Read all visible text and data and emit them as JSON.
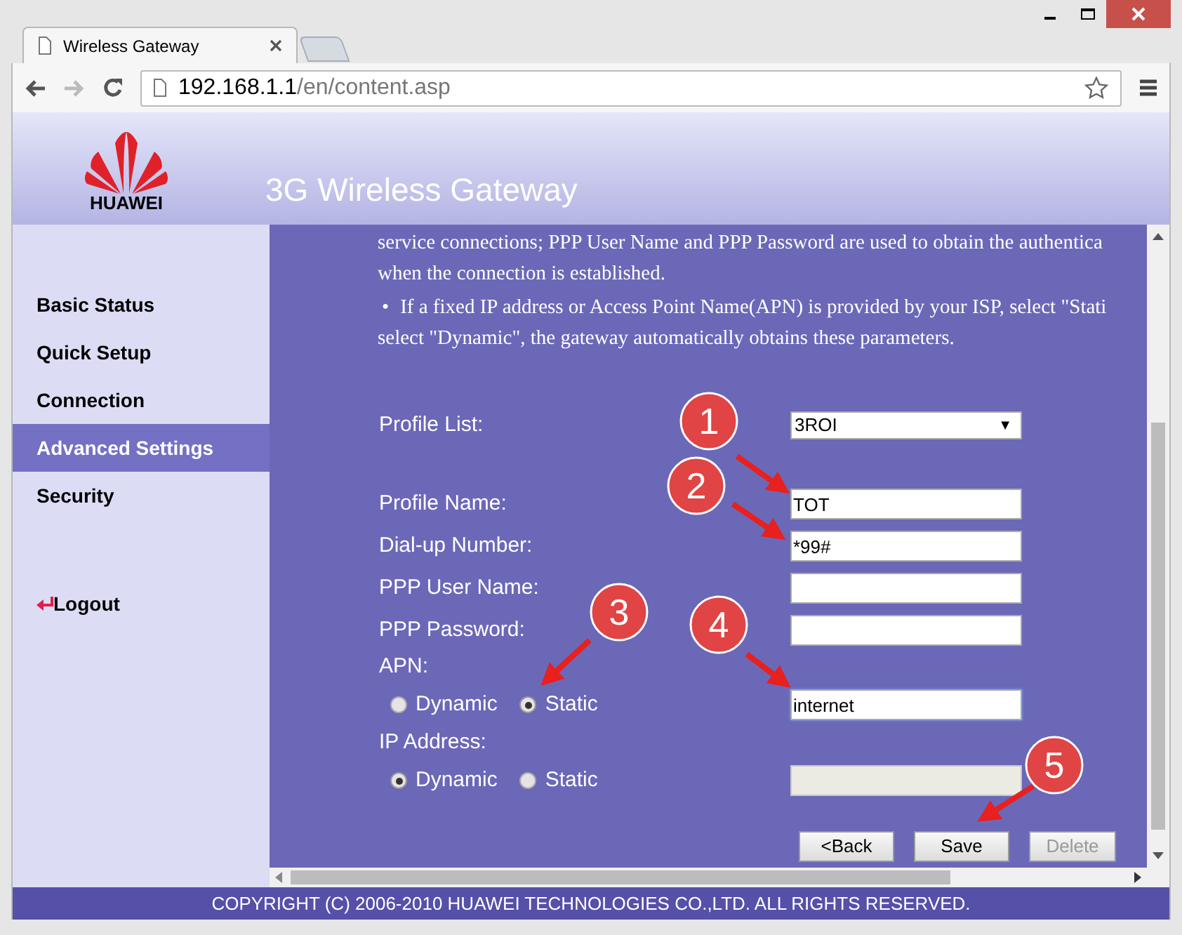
{
  "browser": {
    "tab_title": "Wireless Gateway",
    "url_host": "192.168.1.1",
    "url_path": "/en/content.asp"
  },
  "header": {
    "logo_text": "HUAWEI",
    "title": "3G Wireless Gateway"
  },
  "sidebar": {
    "items": [
      {
        "label": "Basic Status",
        "selected": false
      },
      {
        "label": "Quick Setup",
        "selected": false
      },
      {
        "label": "Connection",
        "selected": false
      },
      {
        "label": "Advanced Settings",
        "selected": true
      },
      {
        "label": "Security",
        "selected": false
      }
    ],
    "logout": "Logout"
  },
  "intro": [
    {
      "kind": "text",
      "text": "service connections; PPP User Name and PPP Password are used to obtain the authentica"
    },
    {
      "kind": "text",
      "text": "when the connection is established."
    },
    {
      "kind": "bullet",
      "bullet": "•",
      "text": "If a fixed IP address or Access Point Name(APN) is provided by your ISP, select \"Stati"
    },
    {
      "kind": "text",
      "text": "select \"Dynamic\", the gateway automatically obtains these parameters."
    }
  ],
  "form": [
    {
      "kind": "select",
      "label": "Profile List:",
      "value": "3ROI",
      "caret": "▼"
    },
    {
      "kind": "gap"
    },
    {
      "kind": "input",
      "label": "Profile Name:",
      "value": "TOT"
    },
    {
      "kind": "input",
      "label": "Dial-up Number:",
      "value": "*99#"
    },
    {
      "kind": "input",
      "label": "PPP User Name:"
    },
    {
      "kind": "input",
      "label": "PPP Password:"
    },
    {
      "kind": "heading",
      "label": "APN:"
    },
    {
      "kind": "radio_input",
      "options": [
        {
          "label": "Dynamic",
          "selected": false
        },
        {
          "label": "Static",
          "selected": true
        }
      ],
      "value": "internet",
      "focused": true,
      "disabled": false
    },
    {
      "kind": "heading",
      "label": "IP Address:"
    },
    {
      "kind": "radio_input",
      "options": [
        {
          "label": "Dynamic",
          "selected": true
        },
        {
          "label": "Static",
          "selected": false
        }
      ],
      "focused": false,
      "disabled": true
    }
  ],
  "buttons": [
    {
      "label": "<Back",
      "disabled": false
    },
    {
      "label": "Save",
      "disabled": false
    },
    {
      "label": "Delete",
      "disabled": true
    }
  ],
  "annotations": [
    {
      "number": "1"
    },
    {
      "number": "2"
    },
    {
      "number": "3"
    },
    {
      "number": "4"
    },
    {
      "number": "5"
    }
  ],
  "footer": "COPYRIGHT (C) 2006-2010 HUAWEI TECHNOLOGIES CO.,LTD. ALL RIGHTS RESERVED."
}
